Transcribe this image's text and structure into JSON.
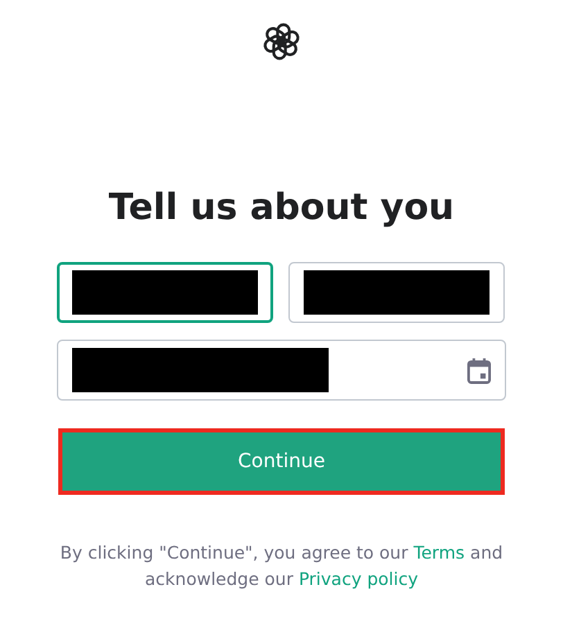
{
  "title": "Tell us about you",
  "fields": [
    {
      "kind": "text",
      "focused": true,
      "redacted": true
    },
    {
      "kind": "text",
      "focused": false,
      "redacted": true
    },
    {
      "kind": "date",
      "focused": false,
      "redacted": true
    }
  ],
  "button": {
    "label": "Continue",
    "highlighted": true
  },
  "footer": [
    {
      "kind": "text",
      "text": "By clicking \"Continue\", you agree to our"
    },
    {
      "kind": "link",
      "text": "Terms"
    },
    {
      "kind": "text",
      "text": "and acknowledge our"
    },
    {
      "kind": "link",
      "text": "Privacy policy"
    }
  ]
}
